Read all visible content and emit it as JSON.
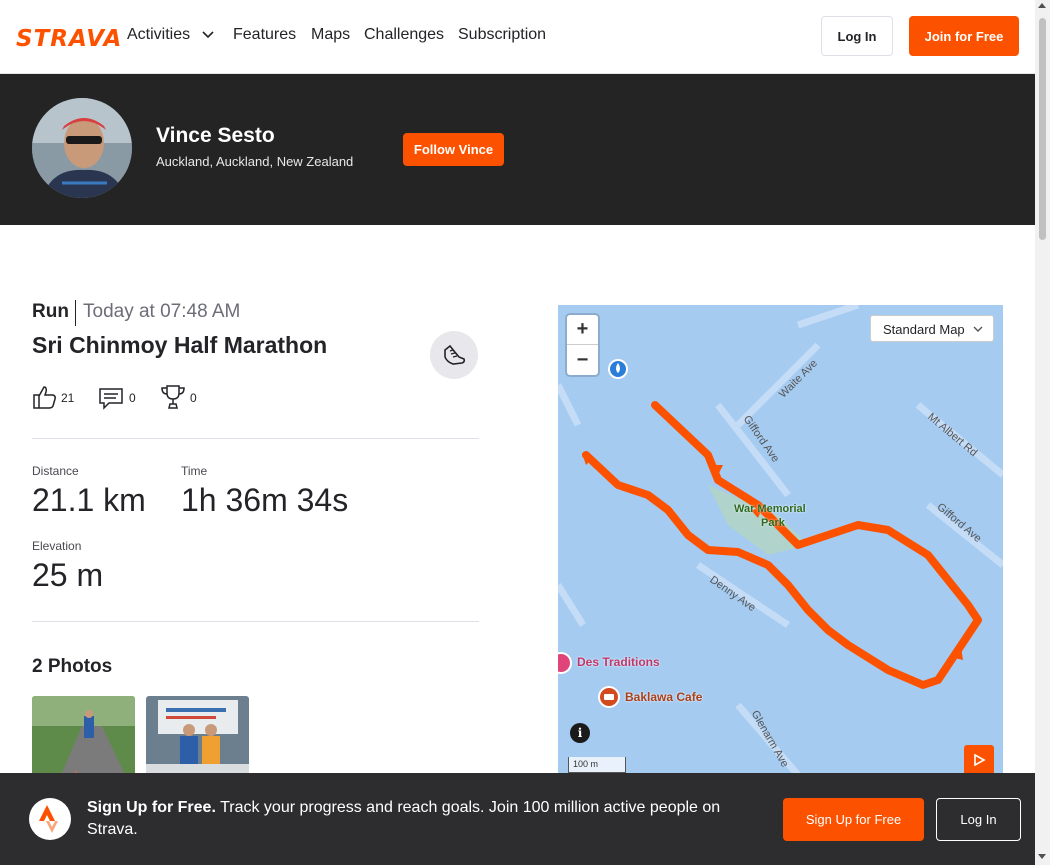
{
  "nav": {
    "logo": "STRAVA",
    "links": [
      "Activities",
      "Features",
      "Maps",
      "Challenges",
      "Subscription"
    ],
    "login_label": "Log In",
    "join_label": "Join for Free"
  },
  "athlete": {
    "name": "Vince Sesto",
    "location": "Auckland, Auckland, New Zealand",
    "follow_label": "Follow Vince"
  },
  "activity": {
    "type": "Run",
    "date": "Today at 07:48 AM",
    "title": "Sri Chinmoy Half Marathon",
    "kudos_count": "21",
    "comments_count": "0",
    "achievements_count": "0",
    "stats": [
      {
        "label": "Distance",
        "value": "21.1 km"
      },
      {
        "label": "Time",
        "value": "1h 36m 34s"
      },
      {
        "label": "Elevation",
        "value": "25 m"
      }
    ],
    "photos_title": "2 Photos"
  },
  "map": {
    "zoom_in": "+",
    "zoom_out": "−",
    "style_label": "Standard Map",
    "scale_label": "100 m",
    "info": "i",
    "labels": {
      "war_memorial_1": "War Memorial",
      "war_memorial_2": "Park",
      "waite": "Waite Ave",
      "gifford_1": "Gifford Ave",
      "gifford_2": "Gifford Ave",
      "mt_albert": "Mt Albert Rd",
      "denny": "Denny Ave",
      "glenarm": "Glenarm Ave",
      "des_traditions": "Des Traditions",
      "baklawa": "Baklawa Cafe"
    },
    "colors": {
      "route": "#fc5200",
      "water": "#a6cbf1"
    }
  },
  "cta": {
    "bold": "Sign Up for Free.",
    "text": " Track your progress and reach goals. Join 100 million active people on Strava.",
    "signup_label": "Sign Up for Free",
    "login_label": "Log In"
  }
}
